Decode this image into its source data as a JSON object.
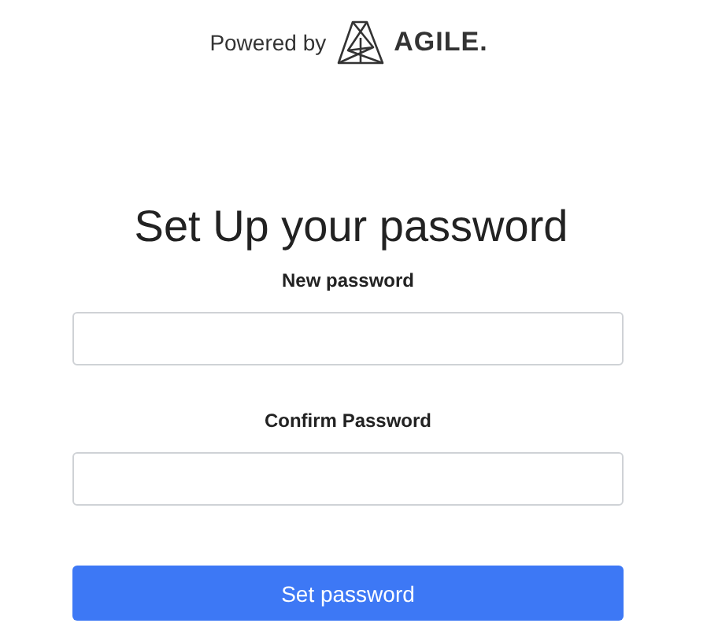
{
  "header": {
    "powered_by": "Powered by",
    "brand": "AGILE."
  },
  "title": "Set Up your password",
  "fields": [
    {
      "label": "New password"
    },
    {
      "label": "Confirm Password"
    }
  ],
  "button": "Set password"
}
